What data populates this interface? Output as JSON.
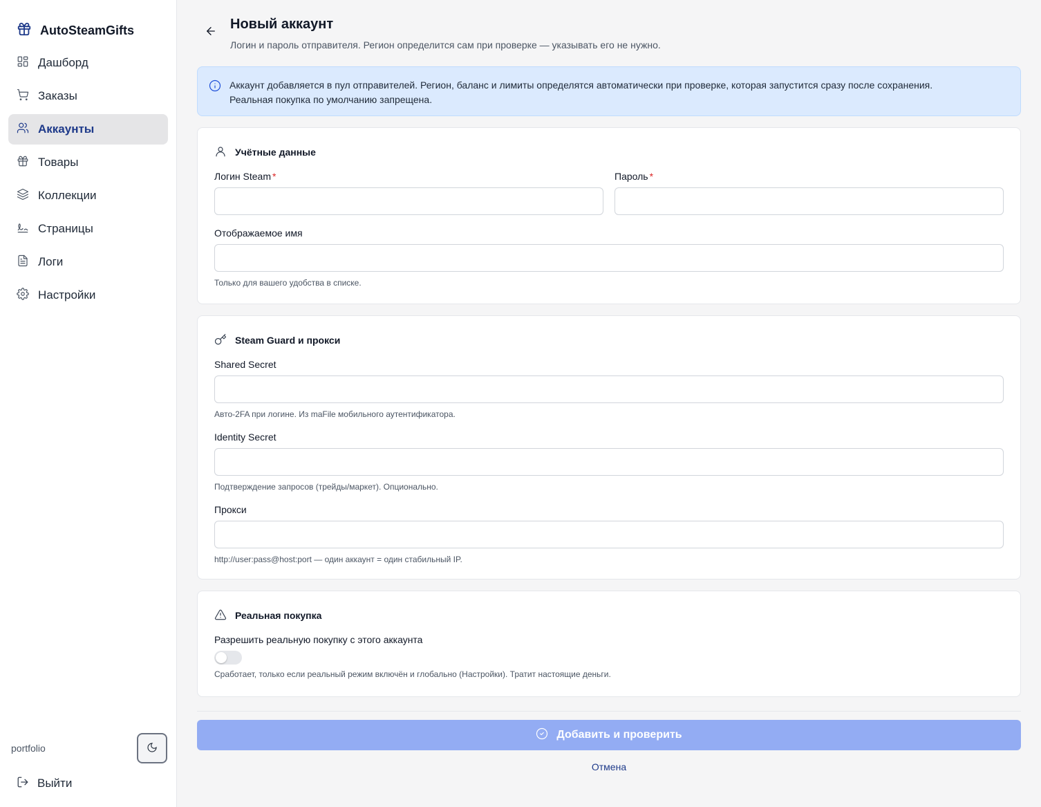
{
  "brand": {
    "name": "AutoSteamGifts",
    "icon": "gift-icon",
    "accent": "#1e3a8a"
  },
  "sidebar": {
    "items": [
      {
        "label": "Дашборд",
        "icon": "dashboard-icon",
        "active": false
      },
      {
        "label": "Заказы",
        "icon": "cart-icon",
        "active": false
      },
      {
        "label": "Аккаунты",
        "icon": "users-icon",
        "active": true
      },
      {
        "label": "Товары",
        "icon": "gift-icon",
        "active": false
      },
      {
        "label": "Коллекции",
        "icon": "layers-icon",
        "active": false
      },
      {
        "label": "Страницы",
        "icon": "signature-icon",
        "active": false
      },
      {
        "label": "Логи",
        "icon": "file-text-icon",
        "active": false
      },
      {
        "label": "Настройки",
        "icon": "gear-icon",
        "active": false
      }
    ],
    "workspace": "portfolio",
    "theme_toggle_icon": "moon-icon",
    "logout_label": "Выйти"
  },
  "header": {
    "title": "Новый аккаунт",
    "subtitle": "Логин и пароль отправителя. Регион определится сам при проверке — указывать его не нужно."
  },
  "info": {
    "line1": "Аккаунт добавляется в пул отправителей. Регион, баланс и лимиты определятся автоматически при проверке, которая запустится сразу после сохранения.",
    "line2": "Реальная покупка по умолчанию запрещена."
  },
  "credentials": {
    "title": "Учётные данные",
    "login_label": "Логин Steam",
    "login_value": "",
    "password_label": "Пароль",
    "password_value": "",
    "required_mark": "*",
    "display_name_label": "Отображаемое имя",
    "display_name_value": "",
    "display_name_hint": "Только для вашего удобства в списке."
  },
  "guard": {
    "title": "Steam Guard и прокси",
    "shared_secret_label": "Shared Secret",
    "shared_secret_value": "",
    "shared_secret_hint": "Авто-2FA при логине. Из maFile мобильного аутентификатора.",
    "identity_secret_label": "Identity Secret",
    "identity_secret_value": "",
    "identity_secret_hint": "Подтверждение запросов (трейды/маркет). Опционально.",
    "proxy_label": "Прокси",
    "proxy_value": "",
    "proxy_hint": "http://user:pass@host:port — один аккаунт = один стабильный IP."
  },
  "real_purchase": {
    "title": "Реальная покупка",
    "toggle_label": "Разрешить реальную покупку с этого аккаунта",
    "enabled": false,
    "hint": "Сработает, только если реальный режим включён и глобально (Настройки). Тратит настоящие деньги."
  },
  "actions": {
    "submit_label": "Добавить и проверить",
    "cancel_label": "Отмена"
  }
}
